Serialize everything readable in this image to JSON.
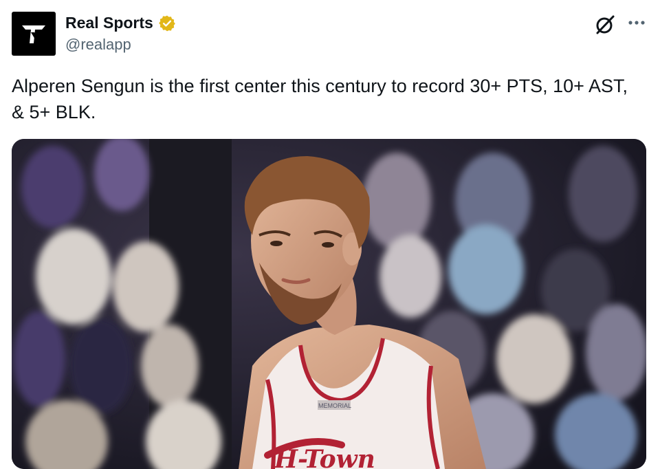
{
  "author": {
    "display_name": "Real Sports",
    "handle": "@realapp",
    "verified_icon": "verified-badge-icon",
    "avatar_icon": "real-sports-logo-icon"
  },
  "actions": {
    "grok_icon": "grok-icon",
    "more_icon": "more-options-icon"
  },
  "tweet": {
    "text": "Alperen Sengun is the first center this century to record 30+ PTS, 10+ AST, & 5+ BLK."
  },
  "media": {
    "jersey_tag": "MEMORIAL",
    "jersey_wordmark": "H-Town"
  },
  "colors": {
    "verified_gold": "#e2b719",
    "text_primary": "#0f1419",
    "text_secondary": "#536471",
    "jersey_red": "#b22234"
  }
}
